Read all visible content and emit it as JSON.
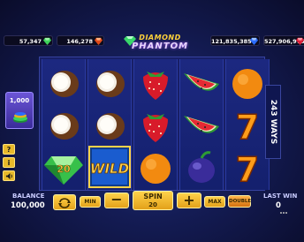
{
  "jackpots": [
    {
      "value": "57,347",
      "gem": "green"
    },
    {
      "value": "146,278",
      "gem": "red"
    },
    {
      "value": "121,835,385",
      "gem": "blue"
    },
    {
      "value": "527,906,975",
      "gem": "red"
    }
  ],
  "logo": {
    "line1": "DIAMOND",
    "line2": "PHANTOM"
  },
  "bet_panel": {
    "value": "1,000"
  },
  "side_buttons": {
    "help": "?",
    "info": "i",
    "sound": "◀"
  },
  "ways": {
    "label": "243 WAYS"
  },
  "reels": [
    [
      "coconut",
      "coconut",
      "diamond-20"
    ],
    [
      "coconut",
      "coconut",
      "wild"
    ],
    [
      "strawberry",
      "strawberry",
      "orange"
    ],
    [
      "watermelon",
      "watermelon",
      "plum"
    ],
    [
      "orange",
      "seven",
      "seven"
    ]
  ],
  "symbols": {
    "diamond_value": "20",
    "wild_label": "WILD",
    "seven_label": "7"
  },
  "bottom": {
    "balance_label": "BALANCE",
    "balance_value": "100,000",
    "min_label": "MIN",
    "minus_label": "−",
    "spin_label": "SPIN",
    "spin_value": "20",
    "plus_label": "+",
    "max_label": "MAX",
    "double_label": "DOUBLE",
    "last_win_label": "LAST WIN",
    "last_win_value": "0"
  },
  "colors": {
    "gold": "#ffd24a",
    "reel_bg": "#1c2880",
    "panel": "#6b55d6"
  }
}
